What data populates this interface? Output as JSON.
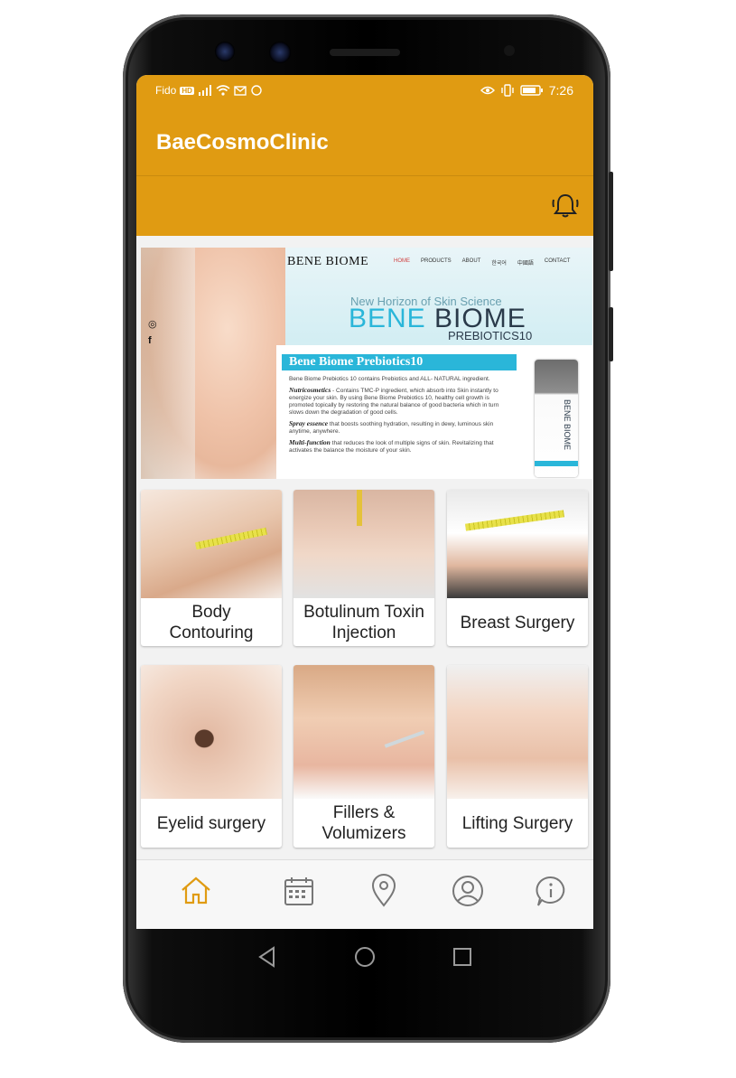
{
  "statusbar": {
    "carrier": "Fido",
    "hd": "HD",
    "time": "7:26"
  },
  "app": {
    "title": "BaeCosmoClinic"
  },
  "banner": {
    "brand_small": "BENE BIOME",
    "nav": [
      "HOME",
      "PRODUCTS",
      "ABOUT",
      "한국어",
      "中國語",
      "CONTACT"
    ],
    "tagline": "New Horizon of Skin Science",
    "brand_big_1": "BENE",
    "brand_big_2": "BIOME",
    "prebiotics": "PREBIOTICS10",
    "insert_title": "Bene Biome Prebiotics10",
    "insert_intro": "Bene Biome Prebiotics 10 contains Prebiotics and ALL- NATURAL ingredient.",
    "p1_head": "Nutricosmetics",
    "p1_text": " - Contains TMC-P ingredient, which absorb into Skin instantly to energize your skin. By using Bene Biome Prebiotics 10, healthy cell growth is promoted topically by restoring the natural balance of good bacteria which in turn slows down the degradation of good cells.",
    "p2_head": "Spray essence",
    "p2_text": " that boosts soothing hydration, resulting in dewy, luminous skin anytime, anywhere.",
    "p3_head": "Multi-function",
    "p3_text": " that reduces the look of multiple signs of skin. Revitalizing that activates the balance the moisture of your skin.",
    "bottle_label": "BENE BIOME"
  },
  "services": [
    {
      "line1": "Body",
      "line2": "Contouring"
    },
    {
      "line1": "Botulinum Toxin",
      "line2": "Injection"
    },
    {
      "line1": "Breast Surgery",
      "line2": ""
    },
    {
      "line1": "Eyelid surgery",
      "line2": ""
    },
    {
      "line1": "Fillers &",
      "line2": "Volumizers"
    },
    {
      "line1": "Lifting Surgery",
      "line2": ""
    }
  ],
  "colors": {
    "primary": "#e09b12",
    "accent_cyan": "#2ab6d9",
    "nav_active": "#e09b12",
    "nav_inactive": "#8a8a8a"
  },
  "bottom_nav": [
    "home-icon",
    "calendar-icon",
    "location-pin-icon",
    "profile-icon",
    "info-icon"
  ]
}
